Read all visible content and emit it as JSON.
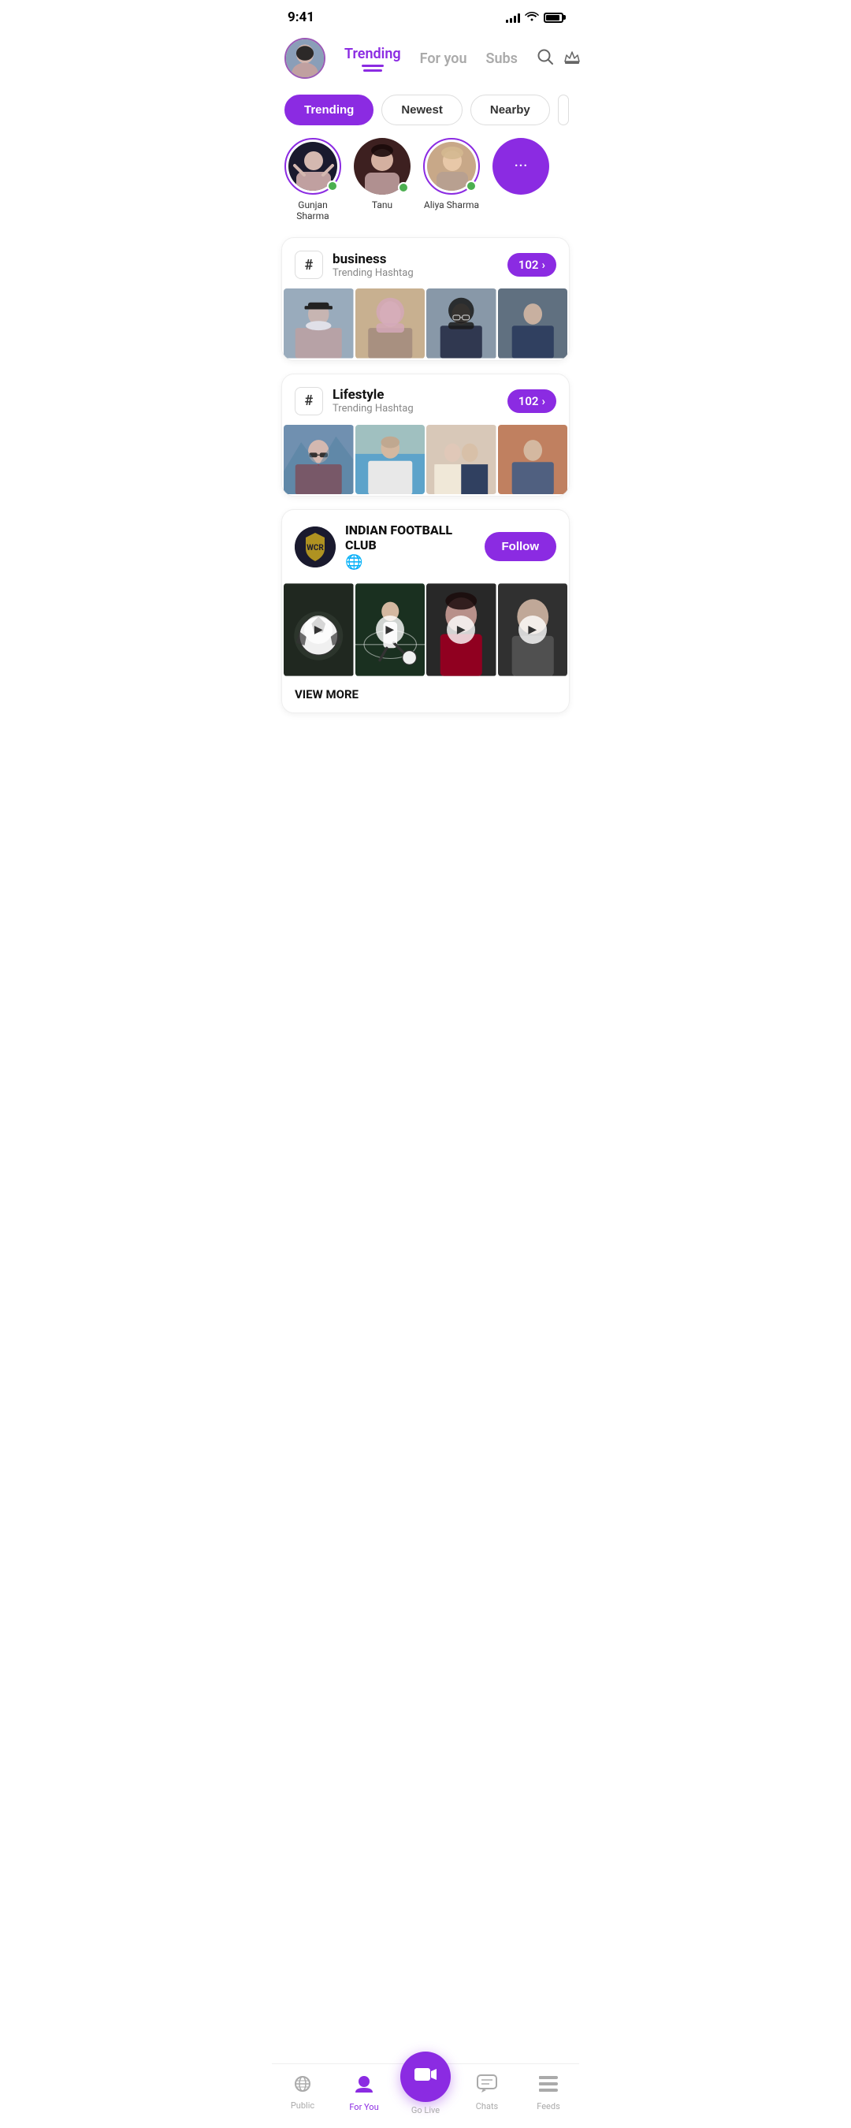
{
  "statusBar": {
    "time": "9:41"
  },
  "header": {
    "tabs": [
      {
        "id": "trending",
        "label": "Trending",
        "active": true
      },
      {
        "id": "for-you",
        "label": "For you",
        "active": false
      },
      {
        "id": "subs",
        "label": "Subs",
        "active": false
      }
    ]
  },
  "filterTabs": [
    {
      "id": "trending",
      "label": "Trending",
      "active": true
    },
    {
      "id": "newest",
      "label": "Newest",
      "active": false
    },
    {
      "id": "nearby",
      "label": "Nearby",
      "active": false
    }
  ],
  "stories": [
    {
      "id": "gunjan",
      "name": "Gunjan Sharma",
      "online": true
    },
    {
      "id": "tanu",
      "name": "Tanu",
      "online": true
    },
    {
      "id": "aliya",
      "name": "Aliya Sharma",
      "online": true
    }
  ],
  "hashtagCards": [
    {
      "id": "business",
      "title": "business",
      "subtitle": "Trending Hashtag",
      "count": "102"
    },
    {
      "id": "lifestyle",
      "title": "Lifestyle",
      "subtitle": "Trending Hashtag",
      "count": "102"
    }
  ],
  "clubCard": {
    "name": "INDIAN FOOTBALL CLUB",
    "followLabel": "Follow",
    "viewMoreLabel": "VIEW MORE",
    "globeIcon": "🌐"
  },
  "bottomNav": [
    {
      "id": "public",
      "label": "Public",
      "icon": "((·))",
      "active": false
    },
    {
      "id": "for-you",
      "label": "For You",
      "icon": "👤",
      "active": true
    },
    {
      "id": "go-live",
      "label": "Go Live",
      "icon": "🎥",
      "center": true
    },
    {
      "id": "chats",
      "label": "Chats",
      "icon": "💬",
      "active": false
    },
    {
      "id": "feeds",
      "label": "Feeds",
      "icon": "☰",
      "active": false
    }
  ]
}
